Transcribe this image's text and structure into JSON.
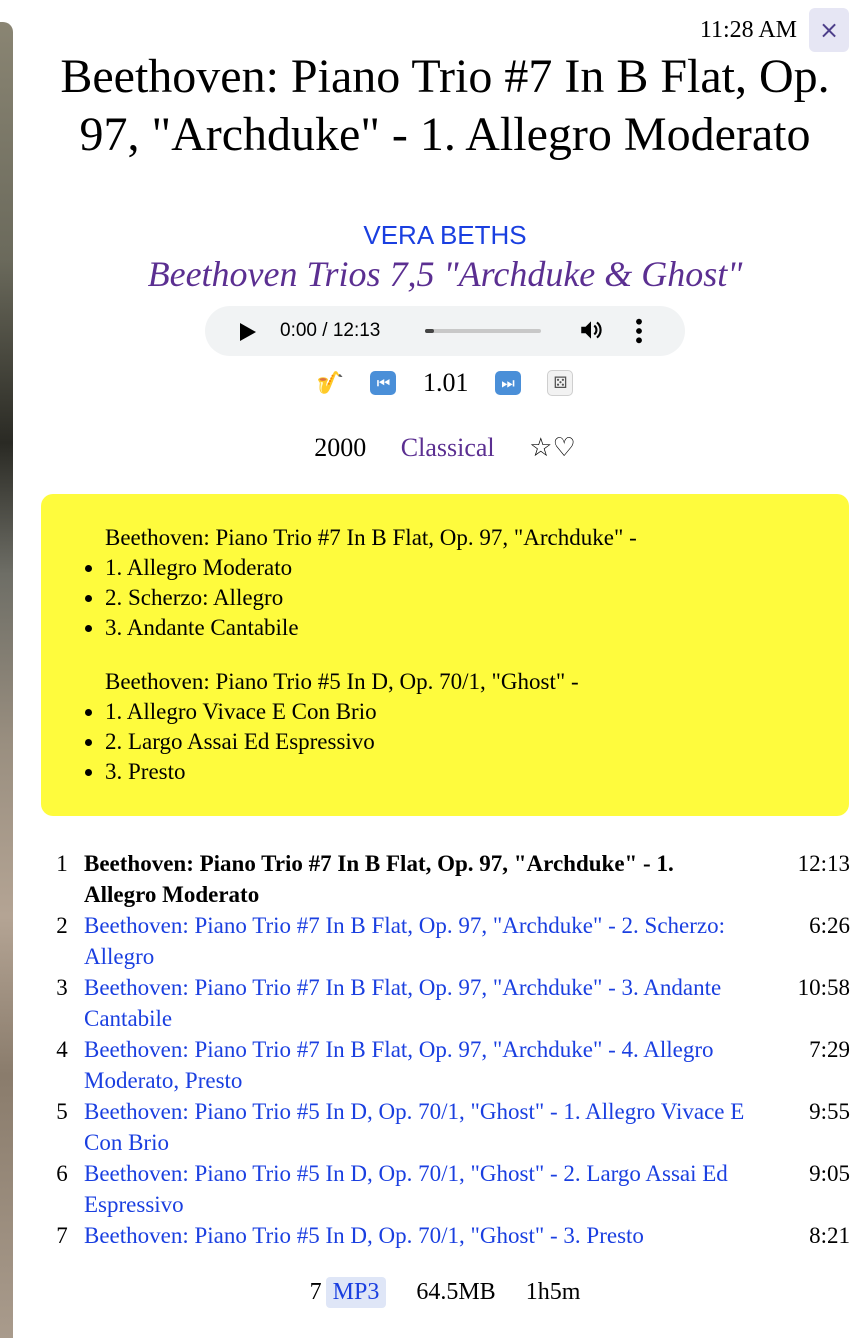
{
  "header": {
    "clock": "11:28 AM",
    "close_label": "×",
    "title": "Beethoven: Piano Trio #7 In B Flat, Op. 97, \"Archduke\" - 1. Allegro Moderato",
    "artist": "VERA BETHS",
    "album": "Beethoven Trios 7,5 \"Archduke & Ghost\""
  },
  "player": {
    "time": "0:00 / 12:13",
    "progress": 0.08
  },
  "controls": {
    "instrument_icon": "🎷",
    "prev_icon": "⏮",
    "speed": "1.01",
    "next_icon": "⏭",
    "dice_icon": "⚄"
  },
  "meta": {
    "year": "2000",
    "genre": "Classical",
    "star": "☆",
    "heart": "♡"
  },
  "works": [
    {
      "title": "Beethoven: Piano Trio #7 In B Flat, Op. 97, \"Archduke\" -",
      "movements": [
        "1. Allegro Moderato",
        "2. Scherzo: Allegro",
        "3. Andante Cantabile"
      ]
    },
    {
      "title": "Beethoven: Piano Trio #5 In D, Op. 70/1, \"Ghost\" -",
      "movements": [
        "1. Allegro Vivace E Con Brio",
        "2. Largo Assai Ed Espressivo",
        "3. Presto"
      ]
    }
  ],
  "tracks": [
    {
      "num": "1",
      "title": "Beethoven: Piano Trio #7 In B Flat, Op. 97, \"Archduke\" - 1. Allegro Moderato",
      "duration": "12:13"
    },
    {
      "num": "2",
      "title": "Beethoven: Piano Trio #7 In B Flat, Op. 97, \"Archduke\" - 2. Scherzo: Allegro",
      "duration": "6:26"
    },
    {
      "num": "3",
      "title": "Beethoven: Piano Trio #7 In B Flat, Op. 97, \"Archduke\" - 3. Andante Cantabile",
      "duration": "10:58"
    },
    {
      "num": "4",
      "title": "Beethoven: Piano Trio #7 In B Flat, Op. 97, \"Archduke\" - 4. Allegro Moderato, Presto",
      "duration": "7:29"
    },
    {
      "num": "5",
      "title": "Beethoven: Piano Trio #5 In D, Op. 70/1, \"Ghost\" - 1. Allegro Vivace E Con Brio",
      "duration": "9:55"
    },
    {
      "num": "6",
      "title": "Beethoven: Piano Trio #5 In D, Op. 70/1, \"Ghost\" - 2. Largo Assai Ed Espressivo",
      "duration": "9:05"
    },
    {
      "num": "7",
      "title": "Beethoven: Piano Trio #5 In D, Op. 70/1, \"Ghost\" - 3. Presto",
      "duration": "8:21"
    }
  ],
  "footer": {
    "count": "7",
    "format": "MP3",
    "size": "64.5MB",
    "length": "1h5m"
  },
  "colors": {
    "link": "#1a3fe0",
    "album": "#5b2f91",
    "highlight_box": "#fefb3d"
  }
}
